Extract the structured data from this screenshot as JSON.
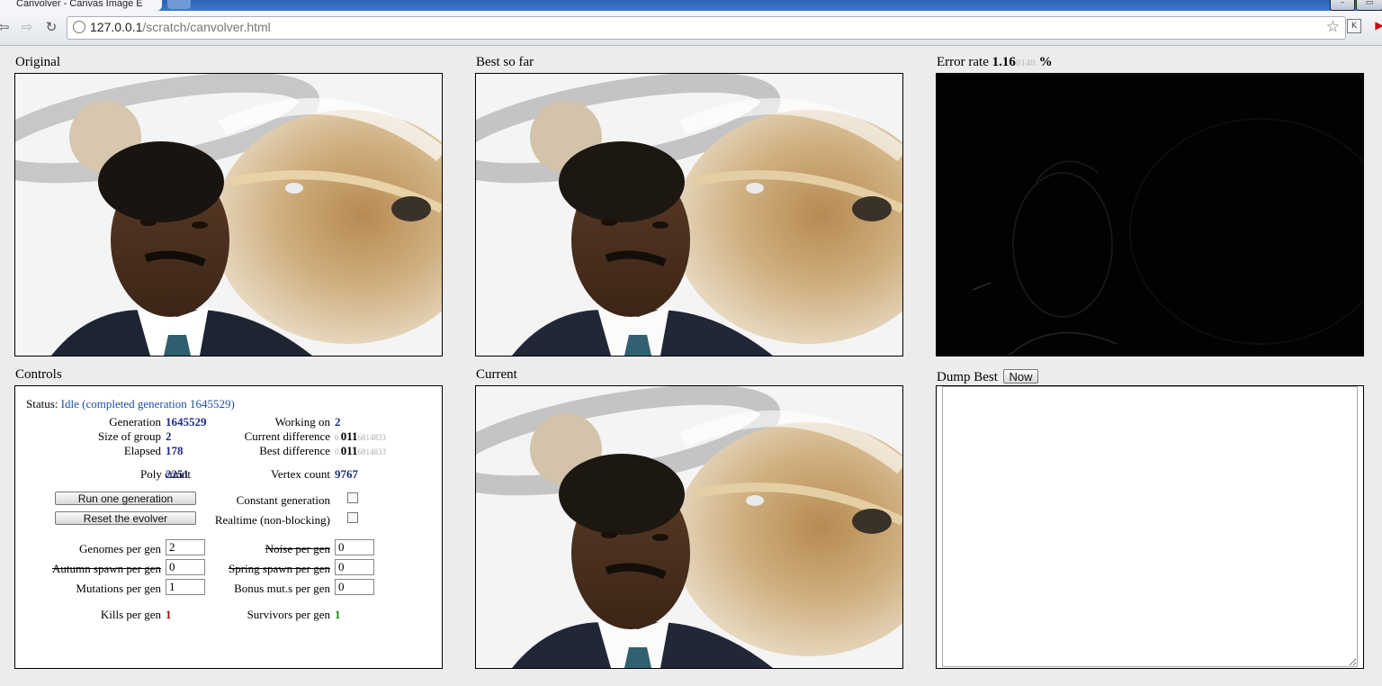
{
  "browser": {
    "tab_title": "Canvolver - Canvas Image E",
    "url_host": "127.0.0.1",
    "url_path": "/scratch/canvolver.html",
    "back_icon": "back-arrow-icon",
    "forward_icon": "forward-arrow-icon",
    "reload_icon": "reload-icon",
    "bookmark_icon": "star-icon",
    "extension_label": "K"
  },
  "panels": {
    "original": "Original",
    "best": "Best so far",
    "error_prefix": "Error rate ",
    "error_big": "1.16",
    "error_small": "8148",
    "error_suffix": " %",
    "controls": "Controls",
    "current": "Current",
    "dump_label": "Dump Best",
    "dump_button": "Now"
  },
  "controls": {
    "status_label": "Status: ",
    "status_value": "Idle (completed generation 1645529)",
    "generation_label": "Generation",
    "generation_value": "1645529",
    "group_label": "Size of group",
    "group_value": "2",
    "elapsed_label": "Elapsed",
    "elapsed_value": "178",
    "working_label": "Working on",
    "working_value": "2",
    "current_diff_label": "Current difference",
    "current_diff_lead": "0.",
    "current_diff_main": "011",
    "current_diff_tail": "6814833",
    "best_diff_label": "Best difference",
    "best_diff_lead": "0.",
    "best_diff_main": "011",
    "best_diff_tail": "6814833",
    "poly_label": "Poly count",
    "poly_value": "2251",
    "vertex_label": "Vertex count",
    "vertex_value": "9767",
    "run_button": "Run one generation",
    "reset_button": "Reset the evolver",
    "constant_label": "Constant generation",
    "realtime_label": "Realtime (non-blocking)",
    "genomes_label": "Genomes per gen",
    "genomes_value": "2",
    "autumn_label": "Autumn spawn per gen",
    "autumn_value": "0",
    "mutations_label": "Mutations per gen",
    "mutations_value": "1",
    "noise_label": "Noise per gen",
    "noise_value": "0",
    "spring_label": "Spring spawn per gen",
    "spring_value": "0",
    "bonus_label": "Bonus mut.s per gen",
    "bonus_value": "0",
    "kills_label": "Kills per gen",
    "kills_value": "1",
    "survivors_label": "Survivors per gen",
    "survivors_value": "1",
    "constant_checked": false,
    "realtime_checked": false
  },
  "colors": {
    "value_blue": "#1b2a8a",
    "status_blue": "#1d4fa3",
    "kills_red": "#a01010",
    "survivors_green": "#1b8a1b"
  }
}
